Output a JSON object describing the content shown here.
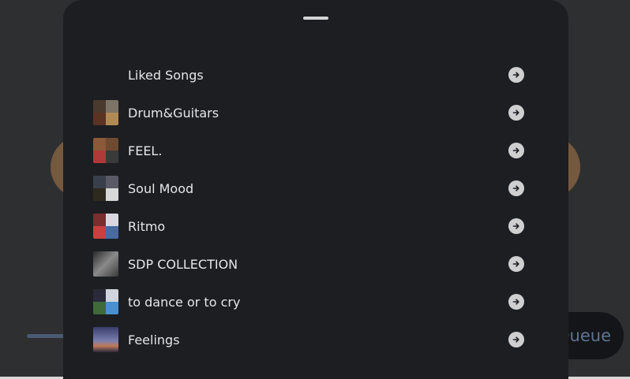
{
  "background": {
    "queue_label": "Queue"
  },
  "playlists": [
    {
      "name": "Liked Songs",
      "thumb": "none",
      "colors": []
    },
    {
      "name": "Drum&Guitars",
      "thumb": "grid",
      "colors": [
        "#4a3a2e",
        "#7d7468",
        "#5b3322",
        "#b08a54"
      ]
    },
    {
      "name": "FEEL.",
      "thumb": "grid",
      "colors": [
        "#8a5a3a",
        "#6e4b30",
        "#b03a3a",
        "#3a3a3a"
      ]
    },
    {
      "name": "Soul Mood",
      "thumb": "grid",
      "colors": [
        "#3a3f4c",
        "#5a5a66",
        "#2e2a1e",
        "#d8d8d8"
      ]
    },
    {
      "name": "Ritmo",
      "thumb": "grid",
      "colors": [
        "#7a2e2e",
        "#d8d8e0",
        "#c84040",
        "#4a6aa0"
      ]
    },
    {
      "name": "SDP COLLECTION",
      "thumb": "single",
      "colors": [
        "#6a6a6a"
      ]
    },
    {
      "name": "to dance or to cry",
      "thumb": "grid",
      "colors": [
        "#2a2a3a",
        "#d0d4dc",
        "#3f6a3a",
        "#4a90d0"
      ]
    },
    {
      "name": "Feelings",
      "thumb": "single",
      "colors": [
        "#7a7fb0"
      ]
    }
  ],
  "icons": {
    "row_action": "arrow-right-circle-icon",
    "handle": "drag-handle"
  }
}
